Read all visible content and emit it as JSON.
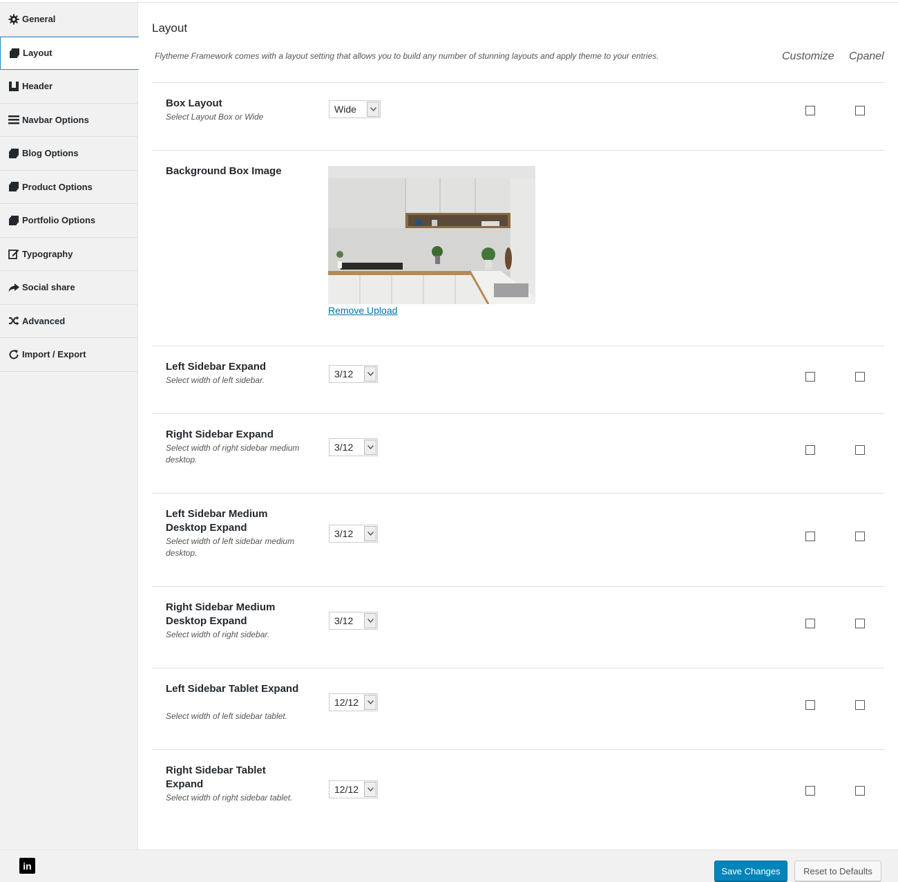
{
  "sidebar": {
    "items": [
      {
        "label": "General",
        "icon": "gear-icon"
      },
      {
        "label": "Layout",
        "icon": "copy-icon"
      },
      {
        "label": "Header",
        "icon": "header-icon"
      },
      {
        "label": "Navbar Options",
        "icon": "bars-icon"
      },
      {
        "label": "Blog Options",
        "icon": "copy-icon"
      },
      {
        "label": "Product Options",
        "icon": "copy-icon"
      },
      {
        "label": "Portfolio Options",
        "icon": "copy-icon"
      },
      {
        "label": "Typography",
        "icon": "edit-icon"
      },
      {
        "label": "Social share",
        "icon": "share-icon"
      },
      {
        "label": "Advanced",
        "icon": "random-icon"
      },
      {
        "label": "Import / Export",
        "icon": "refresh-icon"
      }
    ],
    "active_index": 1
  },
  "main": {
    "title": "Layout",
    "description": "Flytheme Framework comes with a layout setting that allows you to build any number of stunning layouts and apply theme to your entries.",
    "col_customize": "Customize",
    "col_cpanel": "Cpanel",
    "fields": [
      {
        "title": "Box Layout",
        "desc": "Select Layout Box or Wide",
        "value": "Wide"
      },
      {
        "title": "Background Box Image",
        "link": "Remove Upload"
      },
      {
        "title": "Left Sidebar Expand",
        "desc": "Select width of left sidebar.",
        "value": "3/12"
      },
      {
        "title": "Right Sidebar Expand",
        "desc": "Select width of right sidebar medium desktop.",
        "value": "3/12"
      },
      {
        "title": "Left Sidebar Medium Desktop Expand",
        "desc": "Select width of left sidebar medium desktop.",
        "value": "3/12"
      },
      {
        "title": "Right Sidebar Medium Desktop Expand",
        "desc": "Select width of right sidebar.",
        "value": "3/12"
      },
      {
        "title": "Left Sidebar Tablet Expand",
        "desc": "Select width of left sidebar tablet.",
        "value": "12/12"
      },
      {
        "title": "Right Sidebar Tablet Expand",
        "desc": "Select width of right sidebar tablet.",
        "value": "12/12"
      }
    ]
  },
  "footer": {
    "linkedin": "in",
    "save_label": "Save Changes",
    "reset_label": "Reset to Defaults"
  },
  "colors": {
    "primary_button": "#0085ba",
    "link": "#0073aa",
    "active_border": "#1e8cbe"
  }
}
